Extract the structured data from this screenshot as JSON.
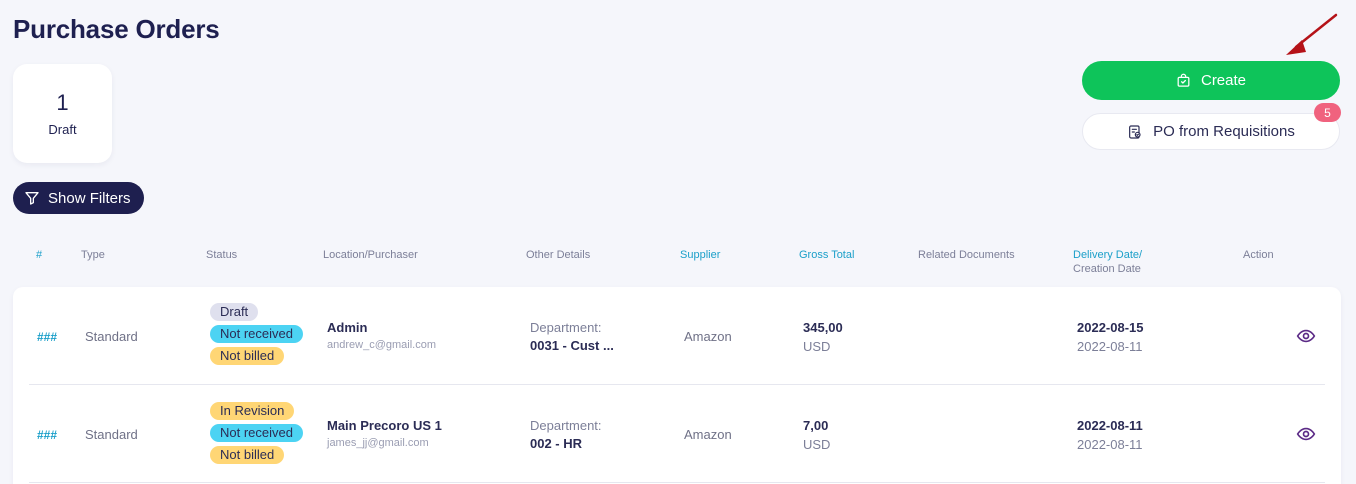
{
  "page": {
    "title": "Purchase Orders"
  },
  "summary": {
    "count": "1",
    "label": "Draft"
  },
  "filters": {
    "label": "Show Filters"
  },
  "actions": {
    "create_label": "Create",
    "po_req_label": "PO from Requisitions",
    "po_req_badge": "5"
  },
  "colors": {
    "primary_green": "#0ec45a",
    "navy": "#1e1f4f",
    "accent_teal": "#1b9fc9",
    "badge_pink": "#f0627e",
    "arrow_red": "#b51218"
  },
  "table": {
    "headers": {
      "num": "#",
      "type": "Type",
      "status": "Status",
      "location": "Location/Purchaser",
      "other": "Other Details",
      "supplier": "Supplier",
      "gross": "Gross Total",
      "related": "Related Documents",
      "delivery": "Delivery Date/",
      "creation": "Creation Date",
      "action": "Action"
    },
    "rows": [
      {
        "num": "###",
        "type": "Standard",
        "statuses": [
          "Draft",
          "Not received",
          "Not billed"
        ],
        "location": "Admin",
        "email": "andrew_c@gmail.com",
        "dept_label": "Department:",
        "dept_value": "0031 - Cust ...",
        "supplier": "Amazon",
        "amount": "345,00",
        "currency": "USD",
        "delivery_date": "2022-08-15",
        "creation_date": "2022-08-11"
      },
      {
        "num": "###",
        "type": "Standard",
        "statuses": [
          "In Revision",
          "Not received",
          "Not billed"
        ],
        "location": "Main Precoro US 1",
        "email": "james_jj@gmail.com",
        "dept_label": "Department:",
        "dept_value": "002 - HR",
        "supplier": "Amazon",
        "amount": "7,00",
        "currency": "USD",
        "delivery_date": "2022-08-11",
        "creation_date": "2022-08-11"
      }
    ]
  },
  "icons": {
    "filter": "filter-icon",
    "create": "shopping-bag-icon",
    "requisition": "document-list-icon",
    "view": "eye-icon",
    "pointer": "red-arrow-annotation"
  }
}
